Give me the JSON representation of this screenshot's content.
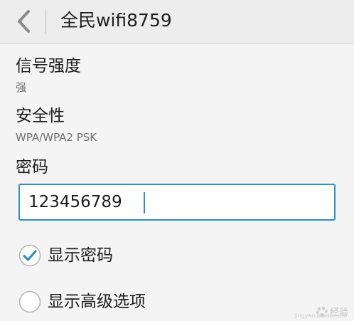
{
  "header": {
    "back_icon": "chevron-left-icon",
    "title": "全民wifi8759"
  },
  "signal": {
    "label": "信号强度",
    "value": "强"
  },
  "security": {
    "label": "安全性",
    "value": "WPA/WPA2 PSK"
  },
  "password": {
    "label": "密码",
    "value": "123456789"
  },
  "options": {
    "show_password": {
      "label": "显示密码",
      "checked": true
    },
    "show_advanced": {
      "label": "显示高级选项",
      "checked": false
    }
  },
  "watermark": {
    "text": "经验",
    "url_text": "jingyan.baidu.com"
  },
  "colors": {
    "accent": "#2f8fc9",
    "background": "#f4f4f4",
    "header_background": "#ededed"
  }
}
